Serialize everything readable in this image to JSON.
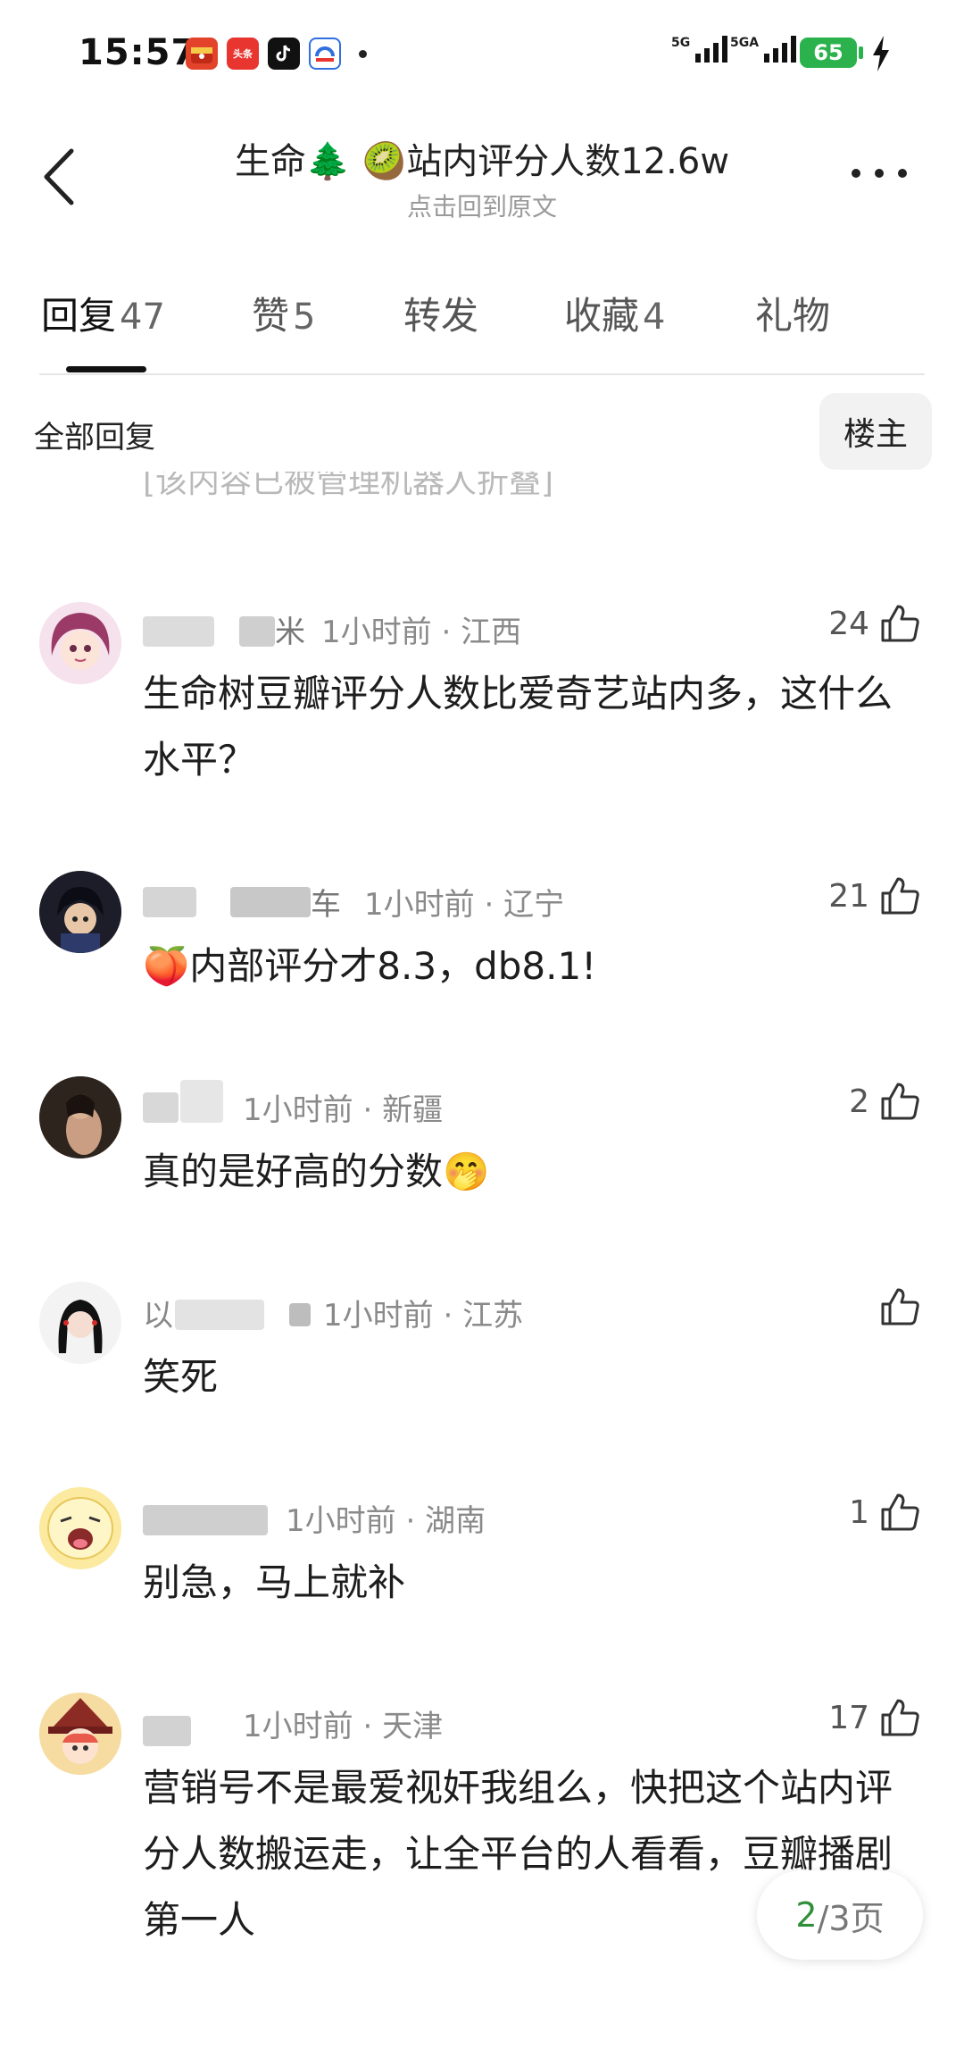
{
  "status": {
    "time": "15:57",
    "net1": "5G",
    "net2": "5GA",
    "battery": "65",
    "app_icons": [
      "calendar-app-icon",
      "toutiao-app-icon",
      "tiktok-app-icon",
      "baidu-app-icon"
    ],
    "toutiao_label": "头条"
  },
  "nav": {
    "title": "生命🌲 🥝站内评分人数12.6w",
    "subtitle": "点击回到原文"
  },
  "tabs": [
    {
      "label": "回复",
      "count": "47"
    },
    {
      "label": "赞",
      "count": "5"
    },
    {
      "label": "转发",
      "count": ""
    },
    {
      "label": "收藏",
      "count": "4"
    },
    {
      "label": "礼物",
      "count": ""
    }
  ],
  "filter": {
    "all_replies": "全部回复",
    "owner": "楼主",
    "clipped": "[该内容已被管理机器人折叠]"
  },
  "comments": [
    {
      "name_tail": "米",
      "time": "1小时前",
      "location": "江西",
      "likes": "24",
      "text": "生命树豆瓣评分人数比爱奇艺站内多，这什么水平？"
    },
    {
      "name_tail": "车",
      "time": "1小时前",
      "location": "辽宁",
      "likes": "21",
      "text": "🍑内部评分才8.3，db8.1!"
    },
    {
      "name_tail": "",
      "time": "1小时前",
      "location": "新疆",
      "likes": "2",
      "text": "真的是好高的分数🤭"
    },
    {
      "name_tail": "",
      "time": "1小时前",
      "location": "江苏",
      "likes": "",
      "text": "笑死"
    },
    {
      "name_tail": "",
      "time": "1小时前",
      "location": "湖南",
      "likes": "1",
      "text": "别急，马上就补"
    },
    {
      "name_tail": "",
      "time": "1小时前",
      "location": "天津",
      "likes": "17",
      "text": "营销号不是最爱视奸我组么，快把这个站内评分人数搬运走，让全平台的人看看，豆瓣播剧第一人"
    }
  ],
  "pagination": {
    "current": "2",
    "total": "/3页"
  },
  "colors": {
    "accent_green": "#2f8f3a",
    "battery_green": "#2bb24c"
  }
}
